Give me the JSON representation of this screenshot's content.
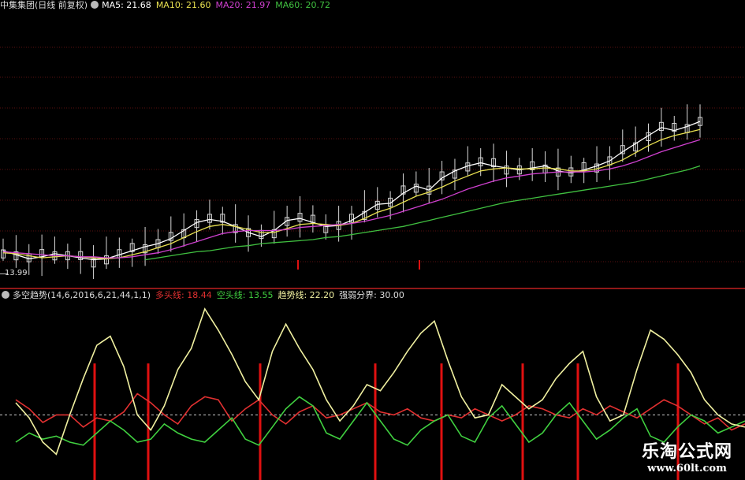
{
  "top_header": {
    "stock_name": "中集集团",
    "period": "(日线 前复权)",
    "ma5": "MA5: 21.68",
    "ma10": "MA10: 21.60",
    "ma20": "MA20: 21.97",
    "ma60": "MA60: 20.72"
  },
  "price_low_label": "13.99",
  "bottom_header": {
    "indicator": "多空趋势(14,6,2016,6,21,44,1,1)",
    "bull_line": "多头线: 18.44",
    "bear_line": "空头线: 13.55",
    "trend_line": "趋势线: 22.20",
    "strength_boundary": "强弱分界: 30.00"
  },
  "watermark": {
    "title": "乐淘公式网",
    "url": "www.60lt.com"
  },
  "colors": {
    "background": "#000000",
    "ma5": "#ffffff",
    "ma10": "#e8e050",
    "ma20": "#d040d0",
    "ma60": "#40c040",
    "bull": "#e03030",
    "bear": "#40d040",
    "trend": "#f0f0a0",
    "separator": "#c02020",
    "candle": "#d8d8d8",
    "volume_bar": "#e01010"
  },
  "chart_data": [
    {
      "type": "line",
      "title": "中集集团(日线 前复权)",
      "series": [
        {
          "name": "MA5",
          "color": "#ffffff",
          "values": [
            15.6,
            15.2,
            14.8,
            15.0,
            15.3,
            15.1,
            14.9,
            14.7,
            14.8,
            15.2,
            15.6,
            16.0,
            16.3,
            16.8,
            17.6,
            18.4,
            18.7,
            18.5,
            18.0,
            17.4,
            17.0,
            17.6,
            18.6,
            18.8,
            18.4,
            18.0,
            18.1,
            18.6,
            19.4,
            20.2,
            20.3,
            21.3,
            22.0,
            21.6,
            22.8,
            23.5,
            24.0,
            24.3,
            24.0,
            23.8,
            23.6,
            23.8,
            24.0,
            23.5,
            23.3,
            23.6,
            24.0,
            24.5,
            25.4,
            26.2,
            27.0,
            27.8,
            27.5,
            27.9,
            28.4
          ]
        },
        {
          "name": "MA10",
          "color": "#e8e050",
          "values": [
            15.4,
            15.3,
            15.1,
            14.9,
            15.0,
            15.1,
            15.0,
            14.9,
            14.8,
            14.9,
            15.2,
            15.5,
            15.9,
            16.3,
            16.9,
            17.5,
            18.0,
            18.2,
            18.0,
            17.7,
            17.4,
            17.4,
            17.8,
            18.2,
            18.3,
            18.2,
            18.1,
            18.3,
            18.8,
            19.4,
            19.8,
            20.4,
            21.0,
            21.4,
            21.9,
            22.5,
            23.0,
            23.5,
            23.7,
            23.8,
            23.7,
            23.7,
            23.8,
            23.7,
            23.5,
            23.5,
            23.7,
            24.1,
            24.6,
            25.3,
            26.0,
            26.6,
            27.0,
            27.3,
            27.6
          ]
        },
        {
          "name": "MA20",
          "color": "#d040d0",
          "values": [
            15.5,
            15.4,
            15.3,
            15.2,
            15.1,
            15.1,
            15.0,
            15.0,
            14.9,
            14.9,
            15.0,
            15.2,
            15.4,
            15.7,
            16.1,
            16.5,
            16.9,
            17.3,
            17.5,
            17.6,
            17.6,
            17.6,
            17.7,
            17.9,
            18.0,
            18.1,
            18.2,
            18.3,
            18.5,
            18.8,
            19.1,
            19.5,
            19.9,
            20.3,
            20.7,
            21.2,
            21.7,
            22.1,
            22.5,
            22.8,
            23.0,
            23.2,
            23.3,
            23.4,
            23.4,
            23.4,
            23.5,
            23.7,
            24.0,
            24.4,
            24.9,
            25.4,
            25.8,
            26.2,
            26.6
          ]
        },
        {
          "name": "MA60",
          "color": "#40c040",
          "values": [
            null,
            null,
            null,
            null,
            null,
            null,
            null,
            null,
            null,
            null,
            null,
            14.7,
            14.9,
            15.1,
            15.3,
            15.5,
            15.6,
            15.8,
            16.0,
            16.1,
            16.3,
            16.4,
            16.5,
            16.6,
            16.7,
            16.9,
            17.0,
            17.2,
            17.4,
            17.6,
            17.8,
            18.0,
            18.3,
            18.6,
            18.9,
            19.2,
            19.5,
            19.8,
            20.1,
            20.4,
            20.6,
            20.8,
            21.0,
            21.2,
            21.4,
            21.6,
            21.8,
            22.0,
            22.2,
            22.4,
            22.7,
            23.0,
            23.3,
            23.6,
            24.0
          ]
        }
      ]
    },
    {
      "type": "line",
      "title": "多空趋势(14,6,2016,6,21,44,1,1)",
      "reference_line": {
        "name": "强弱分界",
        "value": 30
      },
      "series": [
        {
          "name": "多头线",
          "color": "#e03030",
          "values": [
            40,
            34,
            25,
            30,
            30,
            22,
            28,
            26,
            32,
            44,
            38,
            30,
            24,
            36,
            42,
            40,
            26,
            34,
            40,
            30,
            24,
            32,
            36,
            28,
            30,
            34,
            38,
            32,
            30,
            34,
            28,
            26,
            30,
            28,
            34,
            30,
            26,
            30,
            36,
            34,
            30,
            28,
            34,
            30,
            36,
            32,
            28,
            34,
            40,
            36,
            30,
            24,
            28,
            20,
            24
          ]
        },
        {
          "name": "空头线",
          "color": "#40d040",
          "values": [
            12,
            18,
            14,
            16,
            12,
            10,
            18,
            26,
            20,
            12,
            14,
            24,
            18,
            14,
            12,
            20,
            28,
            14,
            10,
            22,
            34,
            42,
            36,
            18,
            14,
            26,
            38,
            26,
            14,
            10,
            20,
            26,
            30,
            16,
            12,
            28,
            36,
            24,
            12,
            18,
            30,
            38,
            26,
            14,
            20,
            28,
            34,
            16,
            12,
            22,
            30,
            26,
            18,
            22,
            26
          ]
        },
        {
          "name": "趋势线",
          "color": "#f0f0a0",
          "values": [
            38,
            28,
            12,
            4,
            30,
            54,
            76,
            82,
            62,
            30,
            20,
            36,
            60,
            74,
            100,
            86,
            70,
            52,
            40,
            72,
            90,
            74,
            60,
            40,
            26,
            36,
            50,
            46,
            58,
            72,
            84,
            92,
            66,
            42,
            28,
            30,
            50,
            42,
            34,
            40,
            54,
            64,
            72,
            42,
            26,
            30,
            60,
            86,
            80,
            70,
            58,
            40,
            30,
            24,
            22
          ]
        }
      ]
    }
  ]
}
